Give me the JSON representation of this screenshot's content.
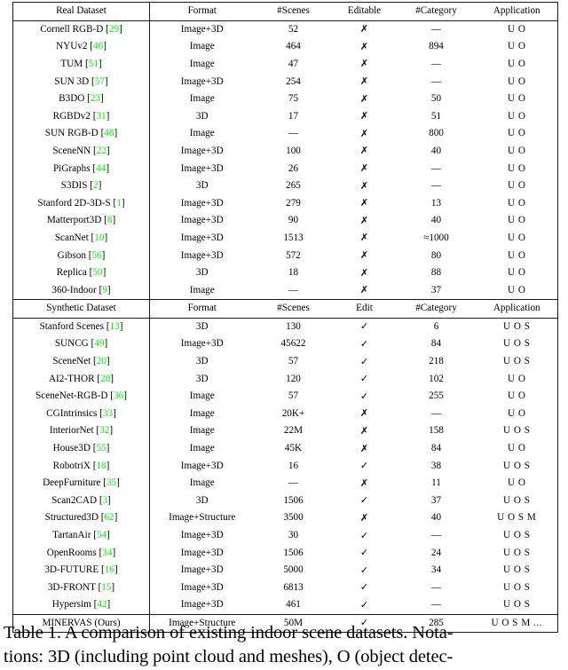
{
  "colors": {
    "citation": "#00ee00",
    "text": "#000000",
    "rule": "#1a1a1a",
    "background": "#ffffff"
  },
  "marks": {
    "yes": "✓",
    "no": "✗",
    "none": "—"
  },
  "table": {
    "sections": [
      {
        "id": "real",
        "header": {
          "name": "Real Dataset",
          "format": "Format",
          "scenes": "#Scenes",
          "edit": "Editable",
          "category": "#Category",
          "application": "Application"
        },
        "rows": [
          {
            "name": "Cornell RGB-D",
            "cite": "29",
            "format": "Image+3D",
            "scenes": "52",
            "edit": "✗",
            "category": "—",
            "application": "U O"
          },
          {
            "name": "NYUv2",
            "cite": "46",
            "format": "Image",
            "scenes": "464",
            "edit": "✗",
            "category": "894",
            "application": "U O"
          },
          {
            "name": "TUM",
            "cite": "51",
            "format": "Image",
            "scenes": "47",
            "edit": "✗",
            "category": "—",
            "application": "U O"
          },
          {
            "name": "SUN 3D",
            "cite": "57",
            "format": "Image+3D",
            "scenes": "254",
            "edit": "✗",
            "category": "—",
            "application": "U O"
          },
          {
            "name": "B3DO",
            "cite": "23",
            "format": "Image",
            "scenes": "75",
            "edit": "✗",
            "category": "50",
            "application": "U O"
          },
          {
            "name": "RGBDv2",
            "cite": "31",
            "format": "3D",
            "scenes": "17",
            "edit": "✗",
            "category": "51",
            "application": "U O"
          },
          {
            "name": "SUN RGB-D",
            "cite": "48",
            "format": "Image",
            "scenes": "—",
            "edit": "✗",
            "category": "800",
            "application": "U O"
          },
          {
            "name": "SceneNN",
            "cite": "22",
            "format": "Image+3D",
            "scenes": "100",
            "edit": "✗",
            "category": "40",
            "application": "U O"
          },
          {
            "name": "PiGraphs",
            "cite": "44",
            "format": "Image+3D",
            "scenes": "26",
            "edit": "✗",
            "category": "—",
            "application": "U O"
          },
          {
            "name": "S3DIS",
            "cite": "2",
            "format": "3D",
            "scenes": "265",
            "edit": "✗",
            "category": "—",
            "application": "U O"
          },
          {
            "name": "Stanford 2D-3D-S",
            "cite": "1",
            "format": "Image+3D",
            "scenes": "279",
            "edit": "✗",
            "category": "13",
            "application": "U O"
          },
          {
            "name": "Matterport3D",
            "cite": "8",
            "format": "Image+3D",
            "scenes": "90",
            "edit": "✗",
            "category": "40",
            "application": "U O"
          },
          {
            "name": "ScanNet",
            "cite": "10",
            "format": "Image+3D",
            "scenes": "1513",
            "edit": "✗",
            "category": "≈1000",
            "application": "U O"
          },
          {
            "name": "Gibson",
            "cite": "56",
            "format": "Image+3D",
            "scenes": "572",
            "edit": "✗",
            "category": "80",
            "application": "U O"
          },
          {
            "name": "Replica",
            "cite": "50",
            "format": "3D",
            "scenes": "18",
            "edit": "✗",
            "category": "88",
            "application": "U O"
          },
          {
            "name": "360-Indoor",
            "cite": "9",
            "format": "Image",
            "scenes": "—",
            "edit": "✗",
            "category": "37",
            "application": "U O"
          }
        ]
      },
      {
        "id": "synthetic",
        "header": {
          "name": "Synthetic Dataset",
          "format": "Format",
          "scenes": "#Scenes",
          "edit": "Edit",
          "category": "#Category",
          "application": "Application"
        },
        "rows": [
          {
            "name": "Stanford Scenes",
            "cite": "13",
            "format": "3D",
            "scenes": "130",
            "edit": "✓",
            "category": "6",
            "application": "U O S"
          },
          {
            "name": "SUNCG",
            "cite": "49",
            "format": "Image+3D",
            "scenes": "45622",
            "edit": "✓",
            "category": "84",
            "application": "U O S"
          },
          {
            "name": "SceneNet",
            "cite": "20",
            "format": "3D",
            "scenes": "57",
            "edit": "✓",
            "category": "218",
            "application": "U O S"
          },
          {
            "name": "AI2-THOR",
            "cite": "28",
            "format": "3D",
            "scenes": "120",
            "edit": "✓",
            "category": "102",
            "application": "U O"
          },
          {
            "name": "SceneNet-RGB-D",
            "cite": "36",
            "format": "Image",
            "scenes": "57",
            "edit": "✓",
            "category": "255",
            "application": "U O"
          },
          {
            "name": "CGIntrinsics",
            "cite": "33",
            "format": "Image",
            "scenes": "20K+",
            "edit": "✗",
            "category": "—",
            "application": "U O"
          },
          {
            "name": "InteriorNet",
            "cite": "32",
            "format": "Image",
            "scenes": "22M",
            "edit": "✗",
            "category": "158",
            "application": "U O S"
          },
          {
            "name": "House3D",
            "cite": "55",
            "format": "Image",
            "scenes": "45K",
            "edit": "✗",
            "category": "84",
            "application": "U O"
          },
          {
            "name": "RobotriX",
            "cite": "18",
            "format": "Image+3D",
            "scenes": "16",
            "edit": "✓",
            "category": "38",
            "application": "U O S"
          },
          {
            "name": "DeepFurniture",
            "cite": "35",
            "format": "Image",
            "scenes": "—",
            "edit": "✗",
            "category": "11",
            "application": "U O"
          },
          {
            "name": "Scan2CAD",
            "cite": "3",
            "format": "3D",
            "scenes": "1506",
            "edit": "✓",
            "category": "37",
            "application": "U O S"
          },
          {
            "name": "Structured3D",
            "cite": "62",
            "format": "Image+Structure",
            "scenes": "3500",
            "edit": "✗",
            "category": "40",
            "application": "U O S M"
          },
          {
            "name": "TartanAir",
            "cite": "54",
            "format": "Image+3D",
            "scenes": "30",
            "edit": "✓",
            "category": "—",
            "application": "U O S"
          },
          {
            "name": "OpenRooms",
            "cite": "34",
            "format": "Image+3D",
            "scenes": "1506",
            "edit": "✓",
            "category": "24",
            "application": "U O S"
          },
          {
            "name": "3D-FUTURE",
            "cite": "16",
            "format": "Image+3D",
            "scenes": "5000",
            "edit": "✓",
            "category": "34",
            "application": "U O S"
          },
          {
            "name": "3D-FRONT",
            "cite": "15",
            "format": "Image+3D",
            "scenes": "6813",
            "edit": "✓",
            "category": "—",
            "application": "U O S"
          },
          {
            "name": "Hypersim",
            "cite": "42",
            "format": "Image+3D",
            "scenes": "461",
            "edit": "✓",
            "category": "—",
            "application": "U O S"
          }
        ]
      }
    ],
    "final_row": {
      "name": "MINERVAS (Ours)",
      "cite": "",
      "format": "Image+Structure",
      "scenes": "50M",
      "edit": "✓",
      "category": "285",
      "application": "U O S M ..."
    }
  },
  "caption": {
    "lines": [
      "Table 1. A comparison of existing indoor scene datasets. Nota-",
      "tions: 3D (including point cloud and meshes), O (object detec-"
    ]
  }
}
